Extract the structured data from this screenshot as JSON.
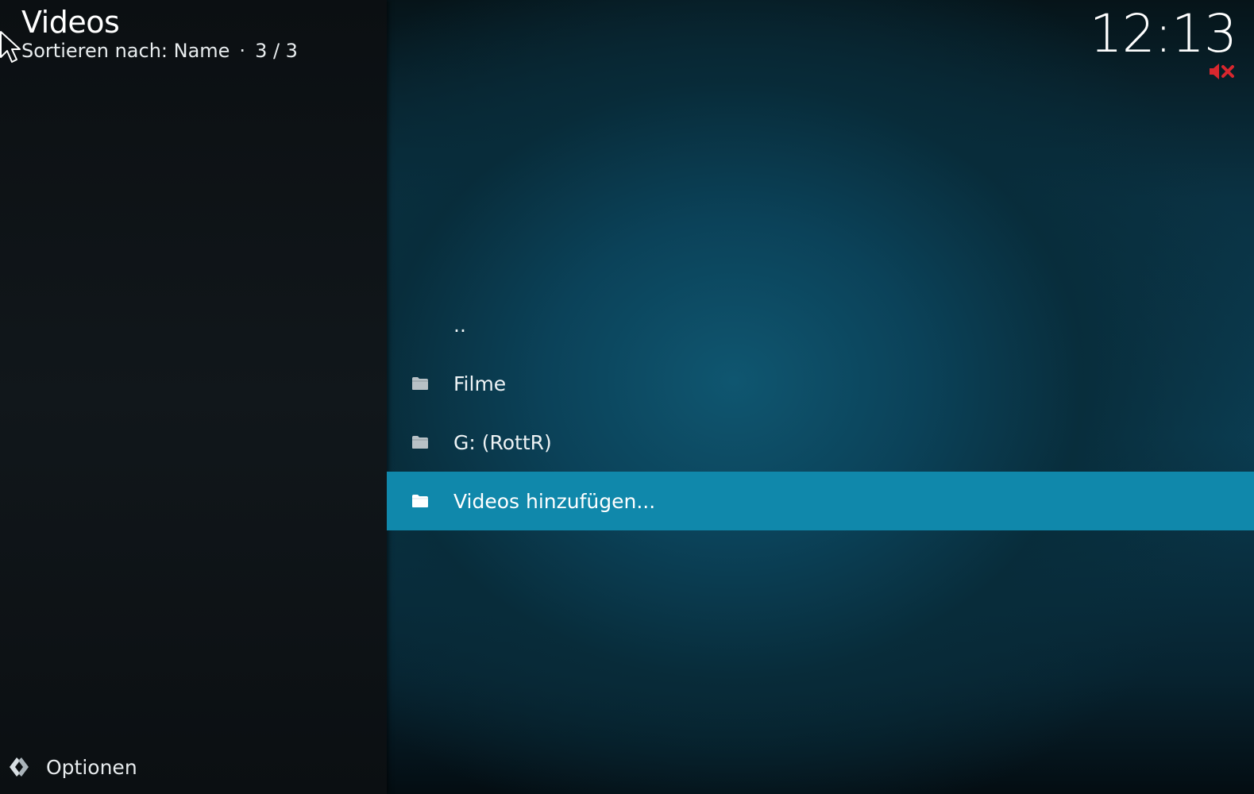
{
  "header": {
    "title": "Videos",
    "sort_label": "Sortieren nach: Name",
    "separator": "·",
    "position": "3 / 3"
  },
  "status": {
    "clock": "12:13",
    "mute_icon": "volume-muted-icon",
    "mute_color": "#d9272e"
  },
  "file_list": {
    "items": [
      {
        "label": "..",
        "icon": "",
        "selected": false
      },
      {
        "label": "Filme",
        "icon": "folder-icon",
        "selected": false
      },
      {
        "label": "G: (RottR)",
        "icon": "folder-icon",
        "selected": false
      },
      {
        "label": "Videos hinzufügen...",
        "icon": "folder-open-icon",
        "selected": true
      }
    ]
  },
  "footer": {
    "options_label": "Optionen",
    "options_icon": "options-icon"
  },
  "theme": {
    "accent": "#1088ab",
    "side_panel": "#11171b"
  }
}
